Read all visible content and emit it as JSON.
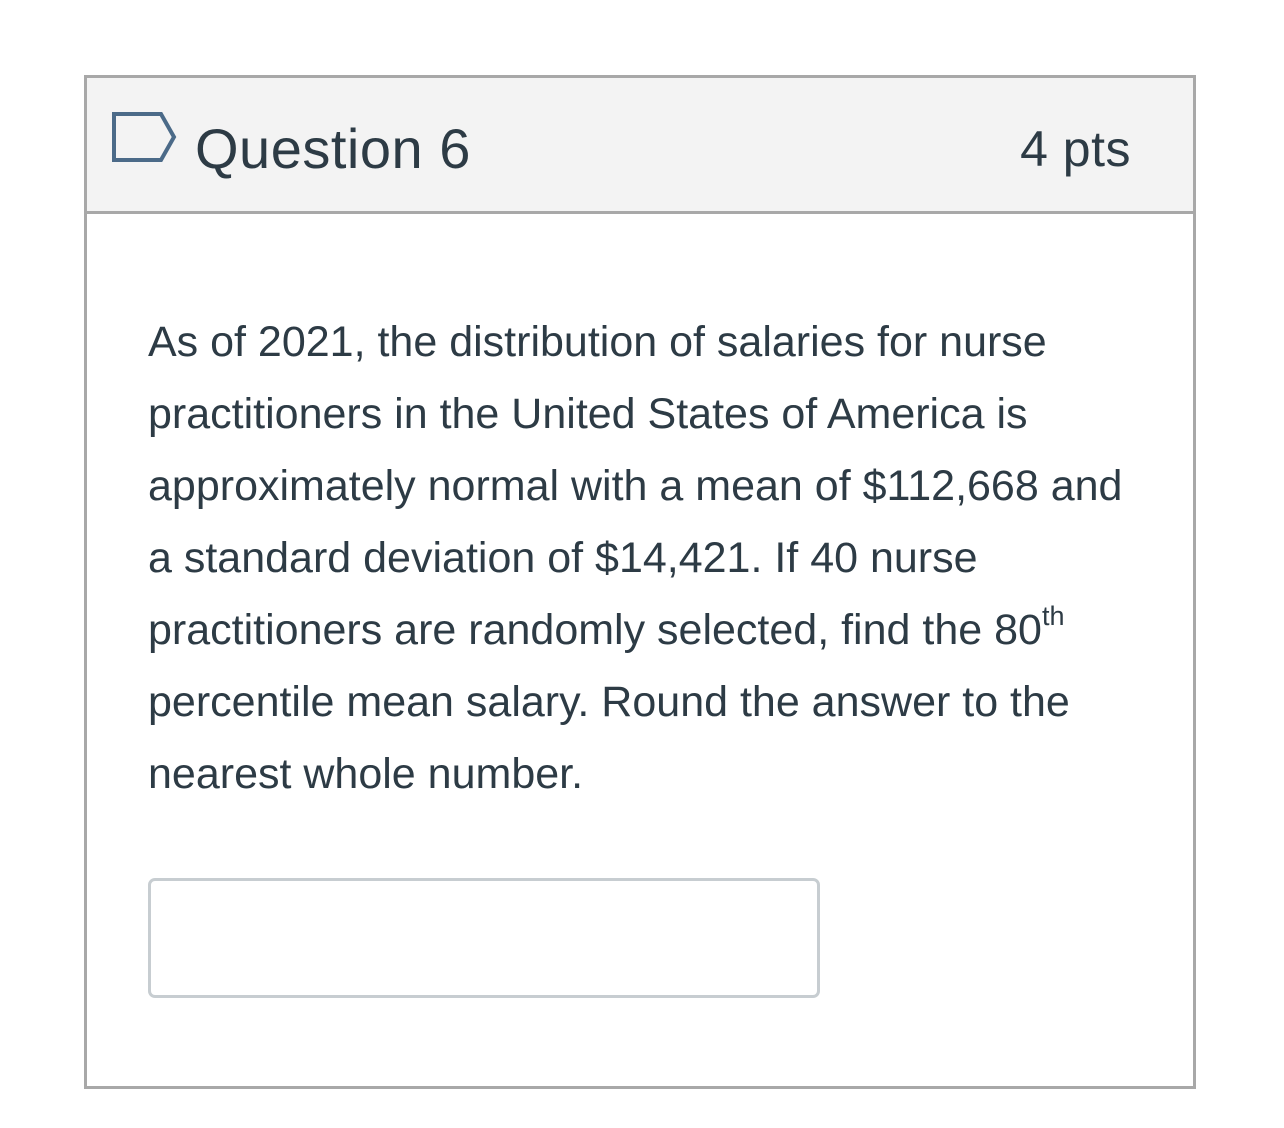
{
  "question": {
    "title": "Question 6",
    "points": "4 pts",
    "flag_icon": "flag-outline-icon",
    "text": {
      "part1": "As of 2021, the distribution of salaries for nurse practitioners in the United States of America is approximately normal with a mean of $112,668 and a standard deviation of $14,421. If 40 nurse practitioners are randomly selected, find the 80",
      "superscript": "th",
      "part2": " percentile mean salary. Round the answer to the nearest whole number."
    },
    "answer": {
      "value": "",
      "placeholder": ""
    }
  },
  "colors": {
    "text": "#2d3b45",
    "header_background": "#f3f3f3",
    "border": "#a8a8a8",
    "flag_stroke": "#4b6a88"
  }
}
